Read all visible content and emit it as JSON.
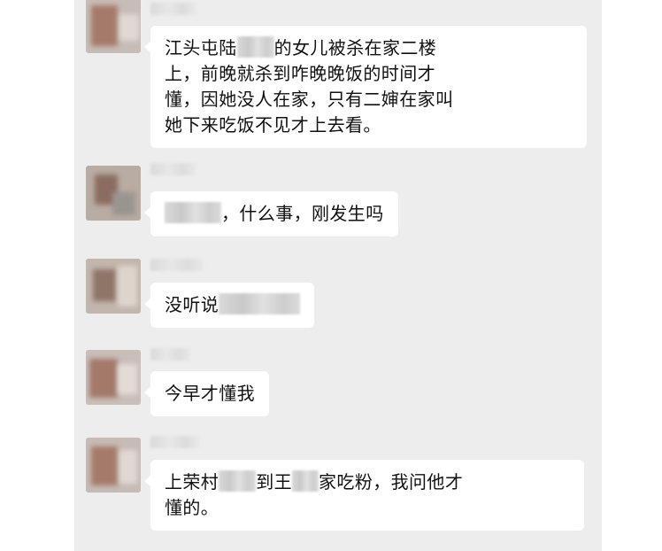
{
  "messages": [
    {
      "lines": [
        [
          "江头屯陆",
          {
            "mosaic": 42
          },
          "的女儿被杀在家二楼"
        ],
        [
          "上，前晚就杀到咋晚晚饭的时间才"
        ],
        [
          "懂，因她没人在家，只有二婶在家叫"
        ],
        [
          "她下来吃饭不见才上去看。"
        ]
      ]
    },
    {
      "lines": [
        [
          {
            "mosaic": 64
          },
          "，什么事，刚发生吗"
        ]
      ]
    },
    {
      "lines": [
        [
          "没听说",
          {
            "mosaic": 92
          }
        ]
      ]
    },
    {
      "lines": [
        [
          "今早才懂我"
        ]
      ]
    },
    {
      "lines": [
        [
          "上荣村",
          {
            "mosaic": 42
          },
          "到王",
          {
            "mosaic": 30
          },
          "家吃粉，我问他才"
        ],
        [
          "懂的。"
        ]
      ]
    }
  ]
}
